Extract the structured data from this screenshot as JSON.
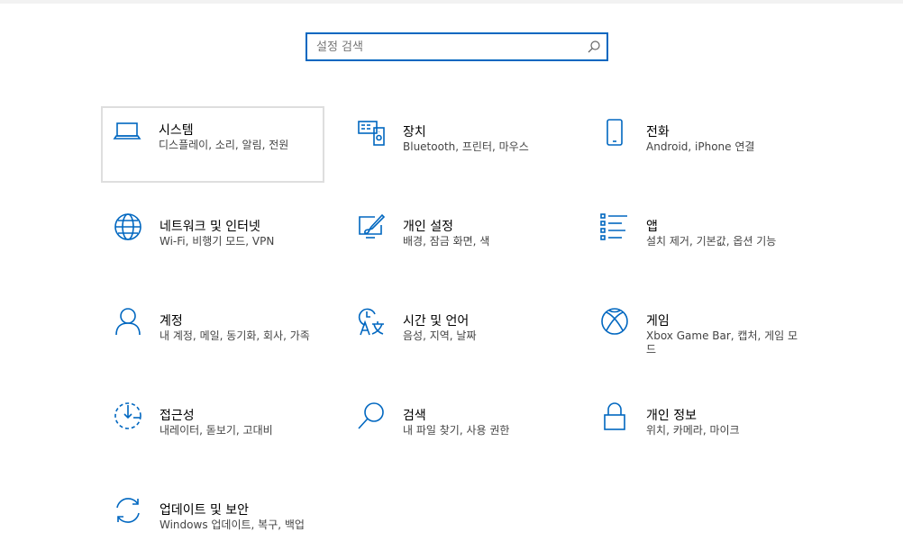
{
  "search": {
    "placeholder": "설정 검색",
    "icon": "search-icon"
  },
  "accent": "#0067c0",
  "tiles": [
    {
      "id": "system",
      "title": "시스템",
      "desc": "디스플레이, 소리, 알림, 전원",
      "icon": "laptop-icon"
    },
    {
      "id": "devices",
      "title": "장치",
      "desc": "Bluetooth, 프린터, 마우스",
      "icon": "devices-icon"
    },
    {
      "id": "phone",
      "title": "전화",
      "desc": "Android, iPhone 연결",
      "icon": "phone-icon"
    },
    {
      "id": "network",
      "title": "네트워크 및 인터넷",
      "desc": "Wi-Fi, 비행기 모드, VPN",
      "icon": "globe-icon"
    },
    {
      "id": "personalization",
      "title": "개인 설정",
      "desc": "배경, 잠금 화면, 색",
      "icon": "paint-icon"
    },
    {
      "id": "apps",
      "title": "앱",
      "desc": "설치 제거, 기본값, 옵션 기능",
      "icon": "apps-list-icon"
    },
    {
      "id": "accounts",
      "title": "계정",
      "desc": "내 계정, 메일, 동기화, 회사, 가족",
      "icon": "person-icon"
    },
    {
      "id": "time-language",
      "title": "시간 및 언어",
      "desc": "음성, 지역, 날짜",
      "icon": "time-language-icon"
    },
    {
      "id": "gaming",
      "title": "게임",
      "desc": "Xbox Game Bar, 캡처, 게임 모드",
      "icon": "xbox-icon"
    },
    {
      "id": "ease-of-access",
      "title": "접근성",
      "desc": "내레이터, 돋보기, 고대비",
      "icon": "ease-of-access-icon"
    },
    {
      "id": "search",
      "title": "검색",
      "desc": "내 파일 찾기, 사용 권한",
      "icon": "magnifier-icon"
    },
    {
      "id": "privacy",
      "title": "개인 정보",
      "desc": "위치, 카메라, 마이크",
      "icon": "lock-icon"
    },
    {
      "id": "update",
      "title": "업데이트 및 보안",
      "desc": "Windows 업데이트, 복구, 백업",
      "icon": "sync-icon"
    }
  ]
}
